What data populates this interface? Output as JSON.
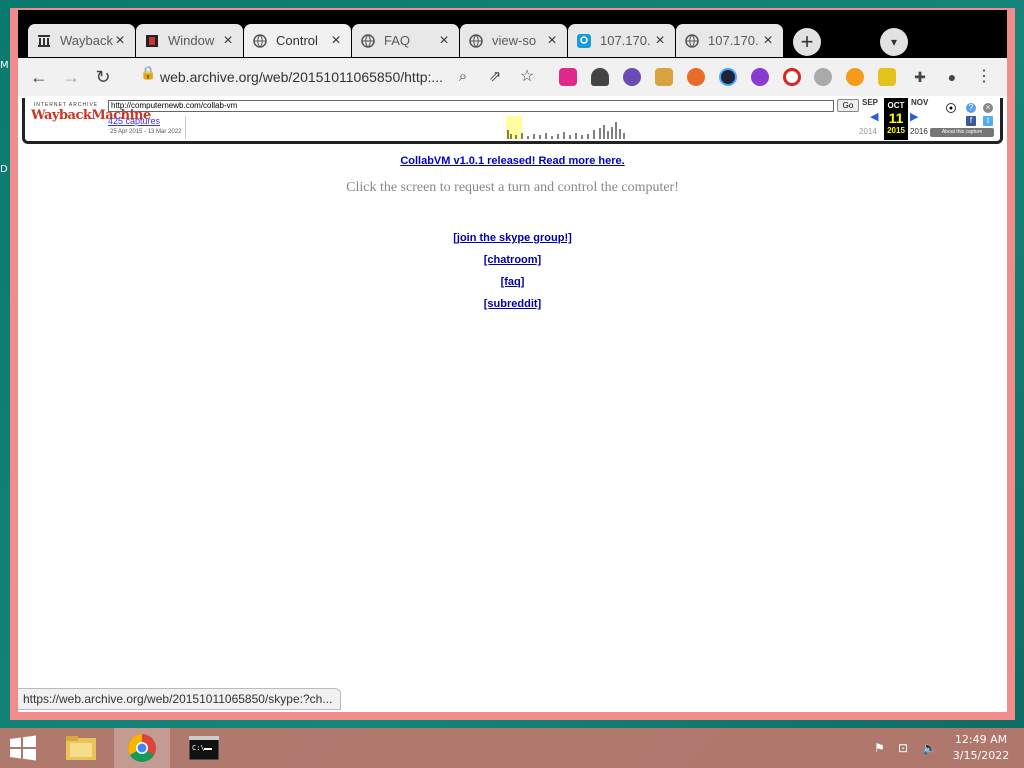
{
  "desktop": {
    "label_m": "M",
    "label_d": "D"
  },
  "tabs": [
    {
      "title": "Wayback",
      "icon": "archive-icon"
    },
    {
      "title": "Window",
      "icon": "film-icon"
    },
    {
      "title": "Control",
      "icon": "globe-icon"
    },
    {
      "title": "FAQ",
      "icon": "globe-icon"
    },
    {
      "title": "view-so",
      "icon": "globe-icon"
    },
    {
      "title": "107.170.",
      "icon": "location-icon"
    },
    {
      "title": "107.170.",
      "icon": "globe-icon"
    }
  ],
  "address": {
    "url": "web.archive.org/web/20151011065850/http:..."
  },
  "wayback": {
    "logo_top": "INTERNET ARCHIVE",
    "logo_main": "WaybackMachine",
    "url_value": "http://computernewb.com/collab-vm",
    "go_label": "Go",
    "captures": "425 captures",
    "range": "25 Apr 2015 - 13 Mar 2022",
    "prev_month": "SEP",
    "cur_month": "OCT",
    "next_month": "NOV",
    "cur_day": "11",
    "prev_year": "2014",
    "cur_year": "2015",
    "next_year": "2016",
    "about": "About this capture"
  },
  "page": {
    "release_link": "CollabVM v1.0.1 released! Read more here.",
    "prompt": "Click the screen to request a turn and control the computer!",
    "links": [
      "[join the skype group!]",
      "[chatroom]",
      "[faq]",
      "[subreddit]"
    ]
  },
  "status_url": "https://web.archive.org/web/20151011065850/skype:?ch...",
  "clock": {
    "time": "12:49 AM",
    "date": "3/15/2022"
  },
  "colors": {
    "window_border": "#f08c8c",
    "taskbar": "#be786e",
    "link": "#0000cc"
  }
}
